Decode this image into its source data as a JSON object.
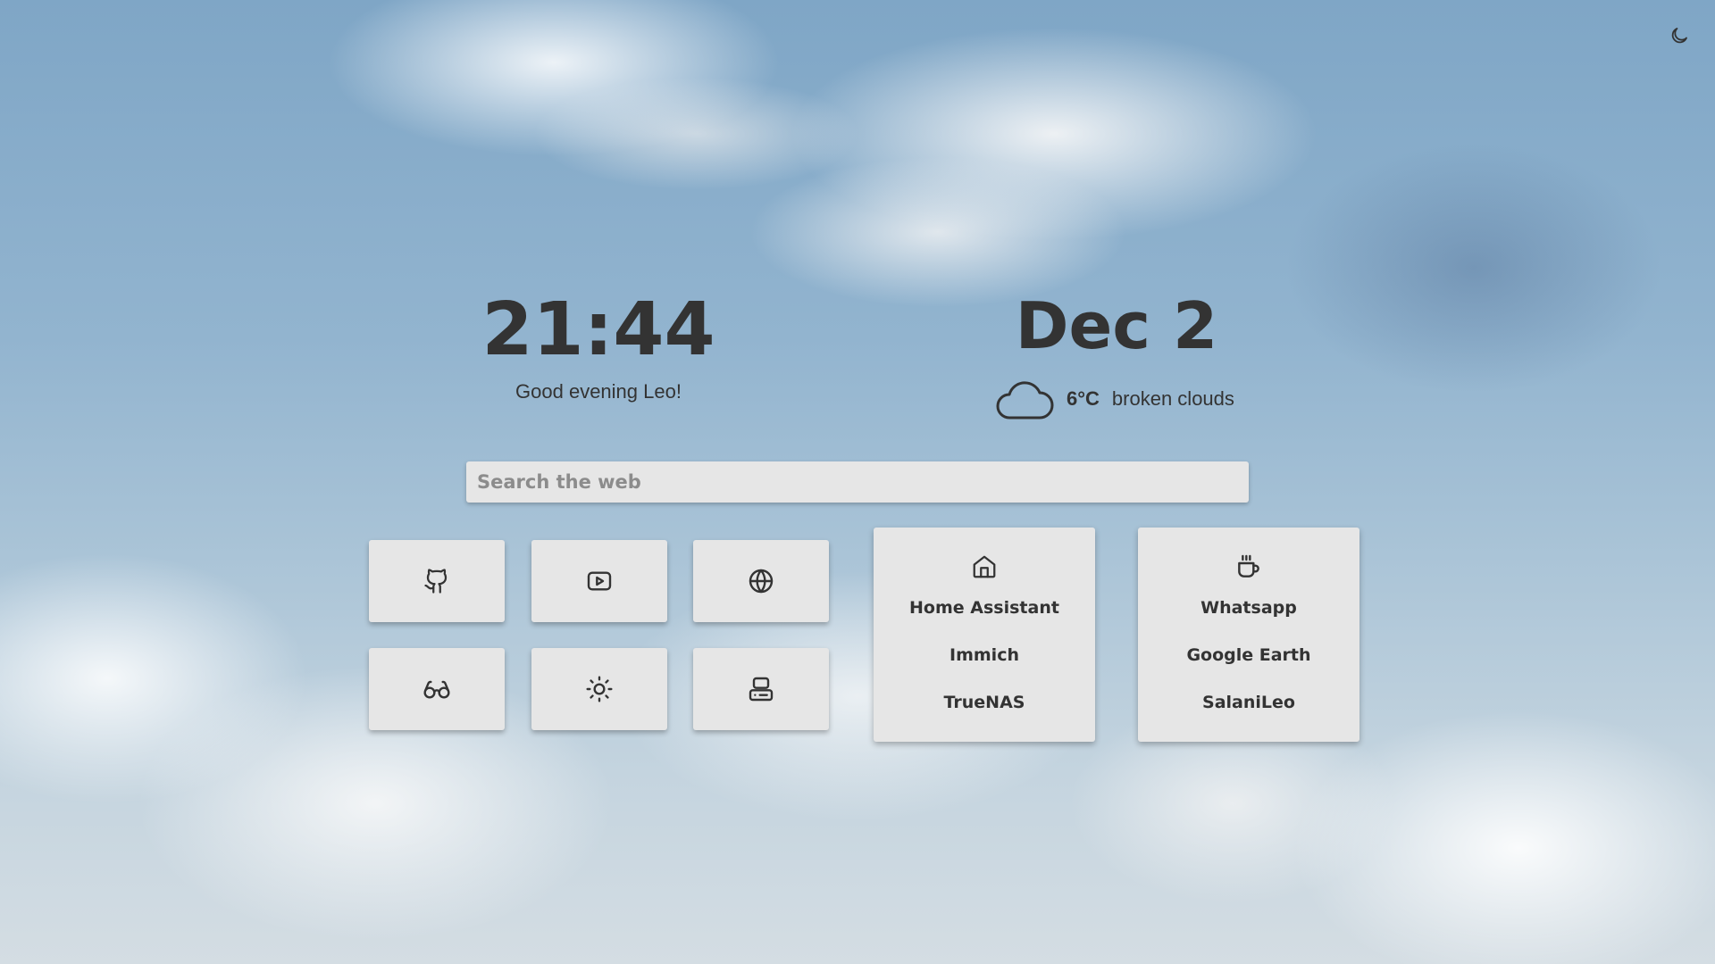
{
  "clock": {
    "time": "21:44",
    "greeting": "Good evening Leo!"
  },
  "date": {
    "text": "Dec 2"
  },
  "weather": {
    "temperature": "6°C",
    "description": "broken clouds",
    "icon": "cloud-icon"
  },
  "search": {
    "placeholder": "Search the web",
    "value": ""
  },
  "theme_toggle": {
    "icon": "moon-icon"
  },
  "shortcut_tiles": [
    {
      "icon": "github-icon"
    },
    {
      "icon": "youtube-icon"
    },
    {
      "icon": "globe-icon"
    },
    {
      "icon": "glasses-icon"
    },
    {
      "icon": "sun-icon"
    },
    {
      "icon": "server-icon"
    }
  ],
  "link_cards": [
    {
      "icon": "home-icon",
      "links": [
        "Home Assistant",
        "Immich",
        "TrueNAS"
      ]
    },
    {
      "icon": "coffee-icon",
      "links": [
        "Whatsapp",
        "Google Earth",
        "SalaniLeo"
      ]
    }
  ],
  "colors": {
    "text": "#333333",
    "tile_background": "#e6e6e6",
    "placeholder": "#8c8c8c"
  }
}
